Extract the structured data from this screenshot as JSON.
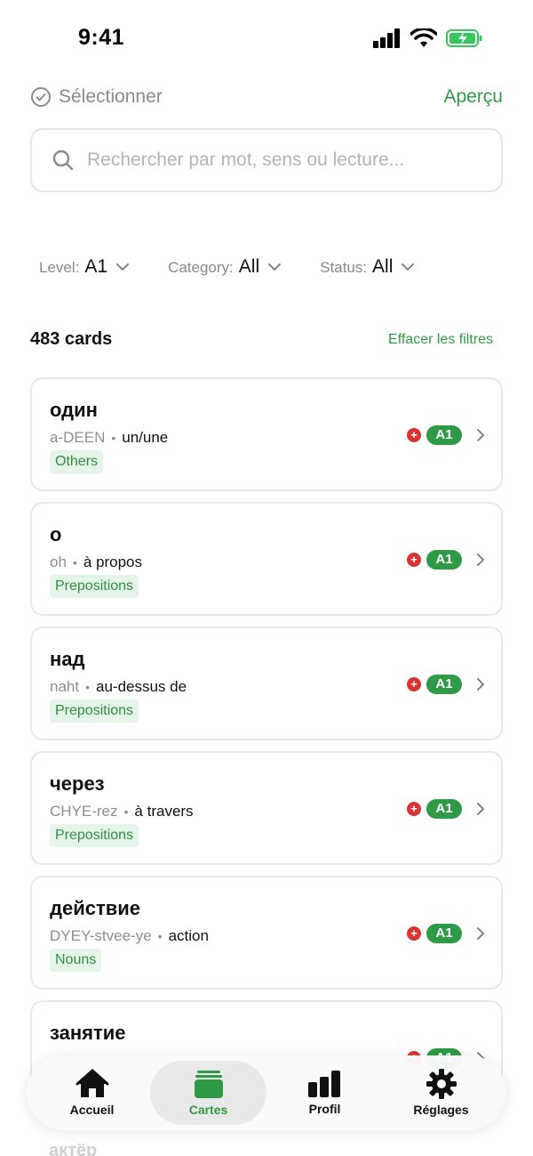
{
  "status_bar": {
    "time": "9:41"
  },
  "header": {
    "select_label": "Sélectionner",
    "preview_label": "Aperçu"
  },
  "search": {
    "placeholder": "Rechercher par mot, sens ou lecture..."
  },
  "filters": [
    {
      "label": "Level:",
      "value": "A1"
    },
    {
      "label": "Category:",
      "value": "All"
    },
    {
      "label": "Status:",
      "value": "All"
    }
  ],
  "results": {
    "count_text": "483 cards",
    "clear_label": "Effacer les filtres"
  },
  "cards": [
    {
      "word": "один",
      "pron": "a-DEEN",
      "meaning": "un/une",
      "tag": "Others",
      "level": "A1"
    },
    {
      "word": "о",
      "pron": "oh",
      "meaning": "à propos",
      "tag": "Prepositions",
      "level": "A1"
    },
    {
      "word": "над",
      "pron": "naht",
      "meaning": "au-dessus de",
      "tag": "Prepositions",
      "level": "A1"
    },
    {
      "word": "через",
      "pron": "CHYE-rez",
      "meaning": "à travers",
      "tag": "Prepositions",
      "level": "A1"
    },
    {
      "word": "действие",
      "pron": "DYEY-stvee-ye",
      "meaning": "action",
      "tag": "Nouns",
      "level": "A1"
    },
    {
      "word": "занятие",
      "pron": "",
      "meaning": "",
      "tag": "",
      "level": "A1"
    }
  ],
  "peek": {
    "text": "актёр"
  },
  "tabbar": {
    "tabs": [
      {
        "label": "Accueil",
        "icon": "home-icon"
      },
      {
        "label": "Cartes",
        "icon": "cards-icon",
        "active": true
      },
      {
        "label": "Profil",
        "icon": "chart-icon"
      },
      {
        "label": "Réglages",
        "icon": "gear-icon"
      }
    ]
  },
  "colors": {
    "accent": "#2f9a45",
    "badge_red": "#d8342f",
    "tag_bg": "#e5f4e8"
  }
}
